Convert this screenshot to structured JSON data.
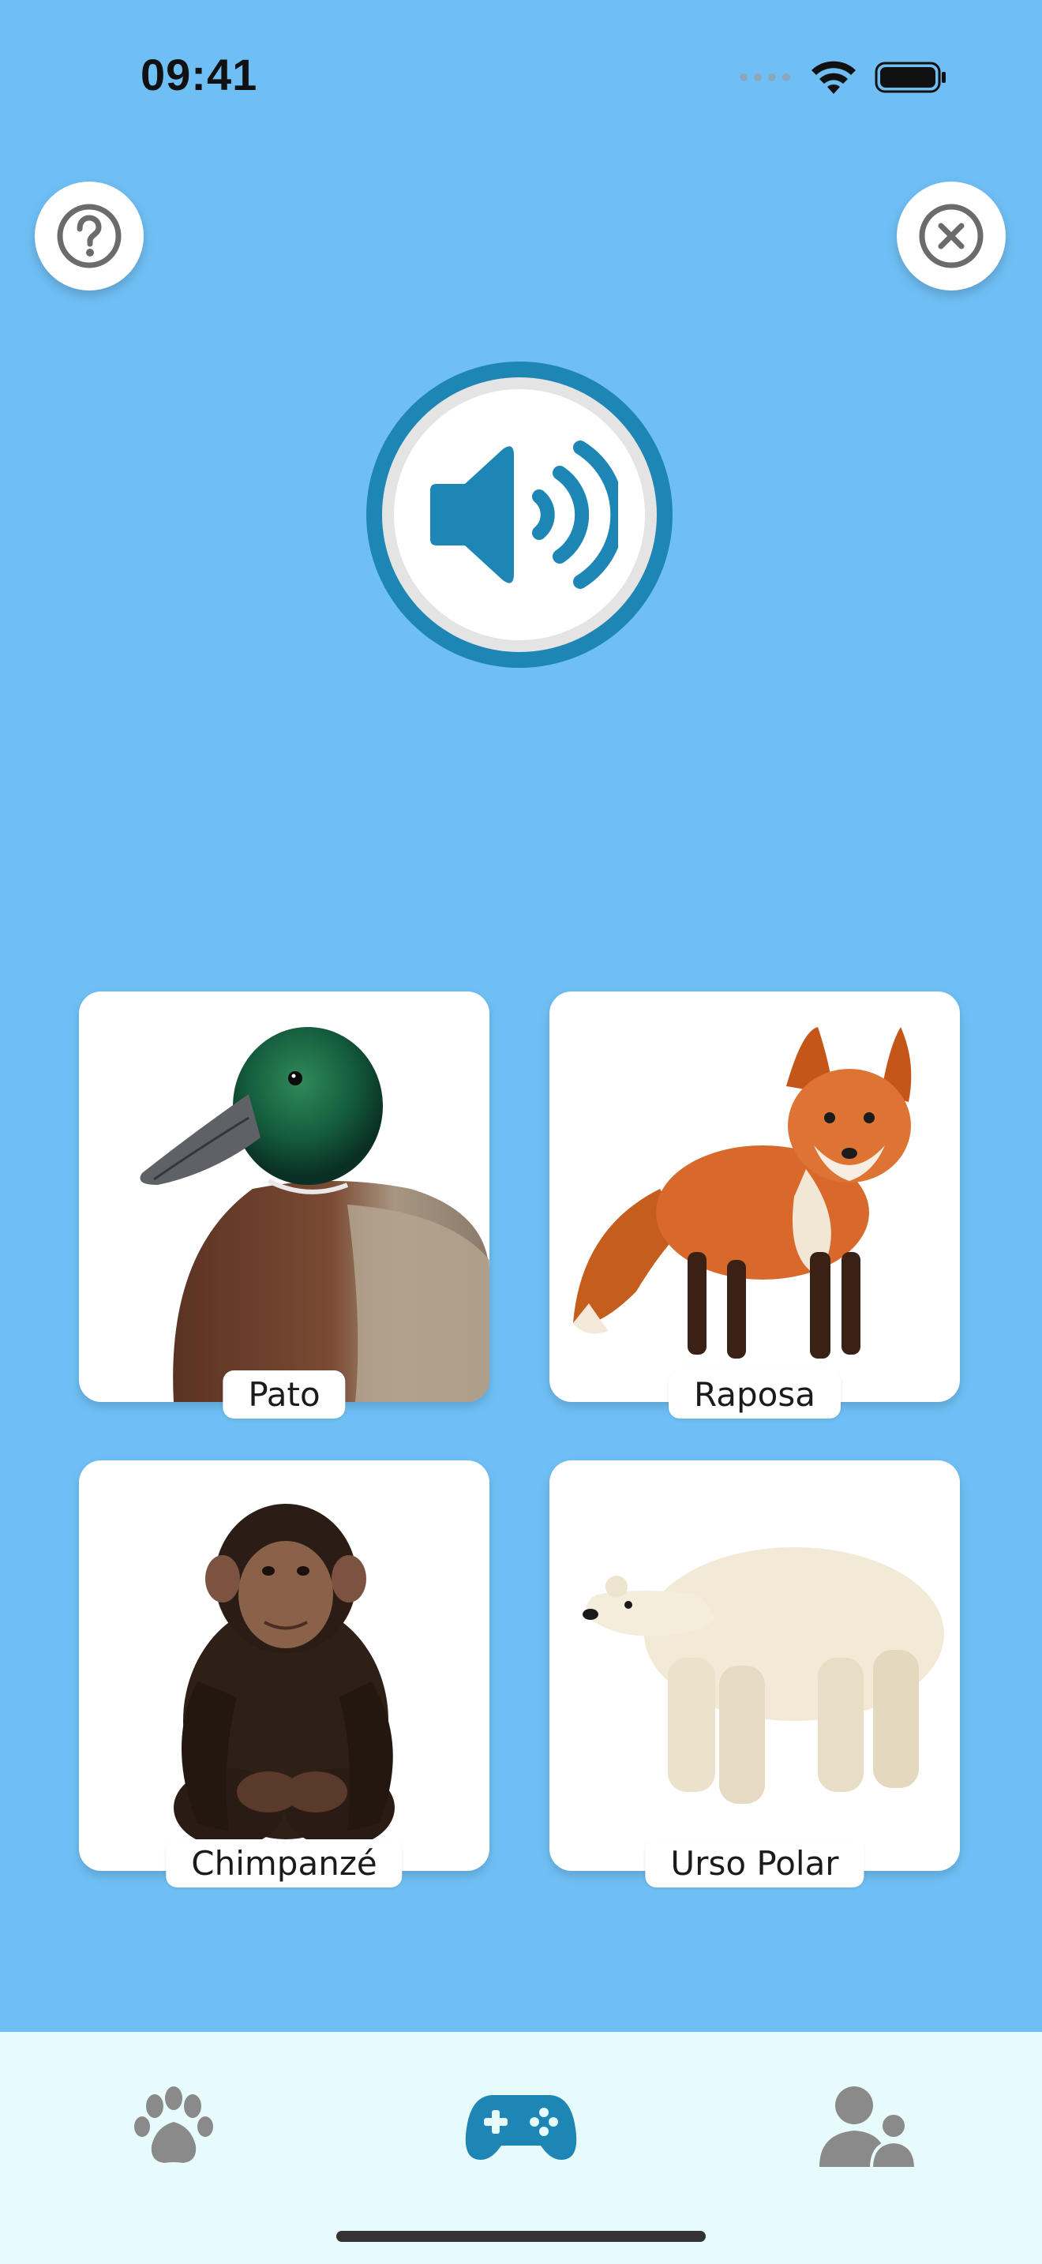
{
  "status_bar": {
    "time": "09:41"
  },
  "header": {
    "help_icon": "question-circle-icon",
    "close_icon": "close-circle-icon"
  },
  "sound": {
    "icon": "speaker-volume-icon",
    "accent_color": "#1E86B5"
  },
  "cards": [
    {
      "label": "Pato",
      "image": "duck"
    },
    {
      "label": "Raposa",
      "image": "fox"
    },
    {
      "label": "Chimpanzé",
      "image": "chimpanzee"
    },
    {
      "label": "Urso Polar",
      "image": "polar-bear"
    }
  ],
  "tabs": [
    {
      "icon": "paw-icon",
      "active": false
    },
    {
      "icon": "gamepad-icon",
      "active": true
    },
    {
      "icon": "users-icon",
      "active": false
    }
  ],
  "colors": {
    "background": "#6FBFF5",
    "tab_bar": "#E8FBFC",
    "active_tab": "#1E86B5",
    "inactive_tab": "#8A8A8A"
  }
}
